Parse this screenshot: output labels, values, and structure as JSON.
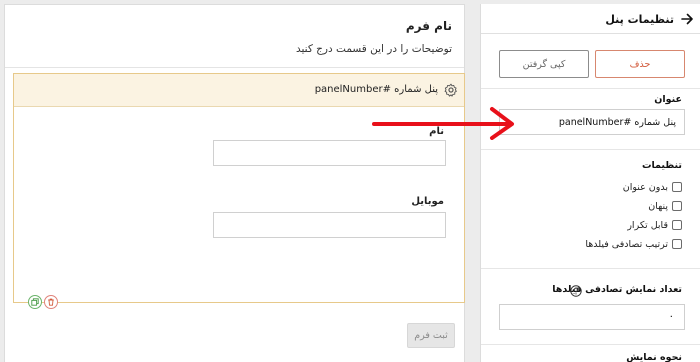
{
  "form": {
    "title": "نام فرم",
    "description": "توضیحات را در این قسمت درج کنید",
    "submit_label": "ثبت فرم"
  },
  "panel": {
    "header_title": "پنل شماره #panelNumber",
    "fields": [
      {
        "label": "نام",
        "value": ""
      },
      {
        "label": "موبایل",
        "value": ""
      }
    ]
  },
  "sidebar": {
    "title": "تنظیمات پنل",
    "delete_label": "حذف",
    "copy_label": "کپی گرفتن",
    "title_label": "عنوان",
    "title_value": "پنل شماره #panelNumber",
    "settings_label": "تنظیمات",
    "checkboxes": [
      {
        "label": "بدون عنوان",
        "checked": false
      },
      {
        "label": "پنهان",
        "checked": false
      },
      {
        "label": "قابل تکرار",
        "checked": false
      },
      {
        "label": "ترتیب تصادفی فیلدها",
        "checked": false
      }
    ],
    "random_count_label": "تعداد نمایش تصادفی فیلدها",
    "random_count_value": "۰",
    "display_mode_label": "نحوه نمایش"
  },
  "colors": {
    "panel_border": "#e7c98a",
    "panel_header_bg": "#fbf3e2",
    "delete_accent": "#d2593a",
    "annotation_arrow": "#e8101a"
  },
  "icons": [
    "gear-icon",
    "back-arrow-icon",
    "help-icon",
    "copy-icon",
    "trash-icon"
  ]
}
